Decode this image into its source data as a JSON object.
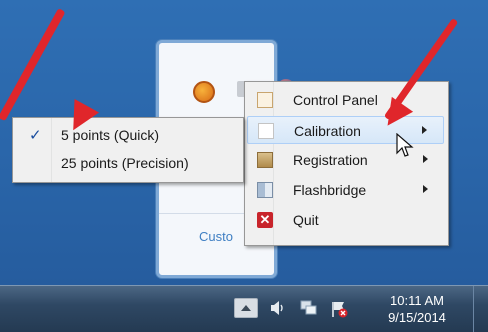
{
  "colors": {
    "desktop": "#2a66aa",
    "arrow": "#e0262b",
    "menu_bg": "#f0f0f0",
    "highlight": "#d6e7f8",
    "link": "#3f7fc3",
    "taskbar": "#2f4864"
  },
  "tray_popup": {
    "customize_label": "Custo",
    "icons": [
      "orange-circle-icon",
      "grey-square-icon",
      "globe-icon"
    ]
  },
  "context_menu": {
    "items": [
      {
        "label": "Control Panel",
        "icon": "control-panel-icon",
        "submenu": false
      },
      {
        "label": "Calibration",
        "icon": "calibration-icon",
        "submenu": true,
        "highlighted": true
      },
      {
        "label": "Registration",
        "icon": "registration-icon",
        "submenu": true
      },
      {
        "label": "Flashbridge",
        "icon": "flashbridge-icon",
        "submenu": true
      },
      {
        "label": "Quit",
        "icon": "quit-icon",
        "submenu": false,
        "icon_glyph": "✕"
      }
    ]
  },
  "submenu": {
    "items": [
      {
        "label": "5 points (Quick)",
        "checked": true,
        "check_glyph": "✓"
      },
      {
        "label": "25 points (Precision)",
        "checked": false
      }
    ]
  },
  "taskbar": {
    "time": "10:11 AM",
    "date": "9/15/2014"
  }
}
